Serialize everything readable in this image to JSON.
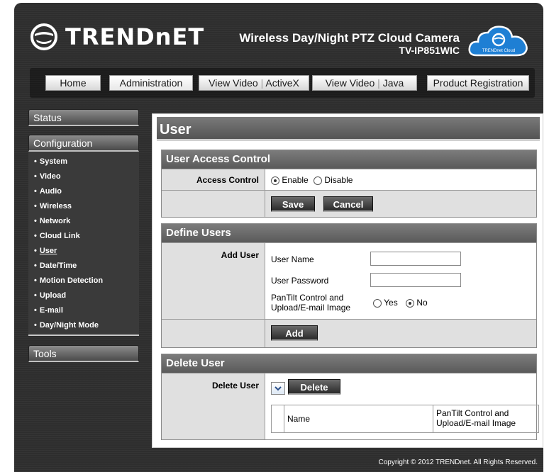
{
  "brand": {
    "logo_text": "TRENDnET",
    "product_name": "Wireless Day/Night PTZ Cloud Camera",
    "product_model": "TV-IP851WIC",
    "cloud_badge": "TRENDnet Cloud"
  },
  "topnav": {
    "home": "Home",
    "administration": "Administration",
    "view_video_activex_a": "View Video",
    "view_video_activex_b": "ActiveX",
    "view_video_java_a": "View Video",
    "view_video_java_b": "Java",
    "product_registration": "Product Registration"
  },
  "sidebar": {
    "status": "Status",
    "configuration": "Configuration",
    "items": [
      "System",
      "Video",
      "Audio",
      "Wireless",
      "Network",
      "Cloud Link",
      "User",
      "Date/Time",
      "Motion Detection",
      "Upload",
      "E-mail",
      "Day/Night Mode"
    ],
    "current_item": "User",
    "tools": "Tools"
  },
  "main": {
    "title": "User",
    "access": {
      "heading": "User Access Control",
      "label": "Access Control",
      "enable": "Enable",
      "disable": "Disable",
      "selected": "Enable",
      "save": "Save",
      "cancel": "Cancel"
    },
    "define": {
      "heading": "Define Users",
      "add_user_label": "Add User",
      "user_name_label": "User Name",
      "user_name_value": "",
      "user_password_label": "User Password",
      "user_password_value": "",
      "pantilt_label_1": "PanTilt Control and",
      "pantilt_label_2": "Upload/E-mail Image",
      "yes": "Yes",
      "no": "No",
      "selected": "No",
      "add": "Add"
    },
    "delete": {
      "heading": "Delete User",
      "label": "Delete User",
      "delete": "Delete",
      "col_name": "Name",
      "col_perm_1": "PanTilt Control and",
      "col_perm_2": "Upload/E-mail Image"
    }
  },
  "footer": {
    "copyright": "Copyright © 2012 TRENDnet.  All Rights Reserved."
  }
}
